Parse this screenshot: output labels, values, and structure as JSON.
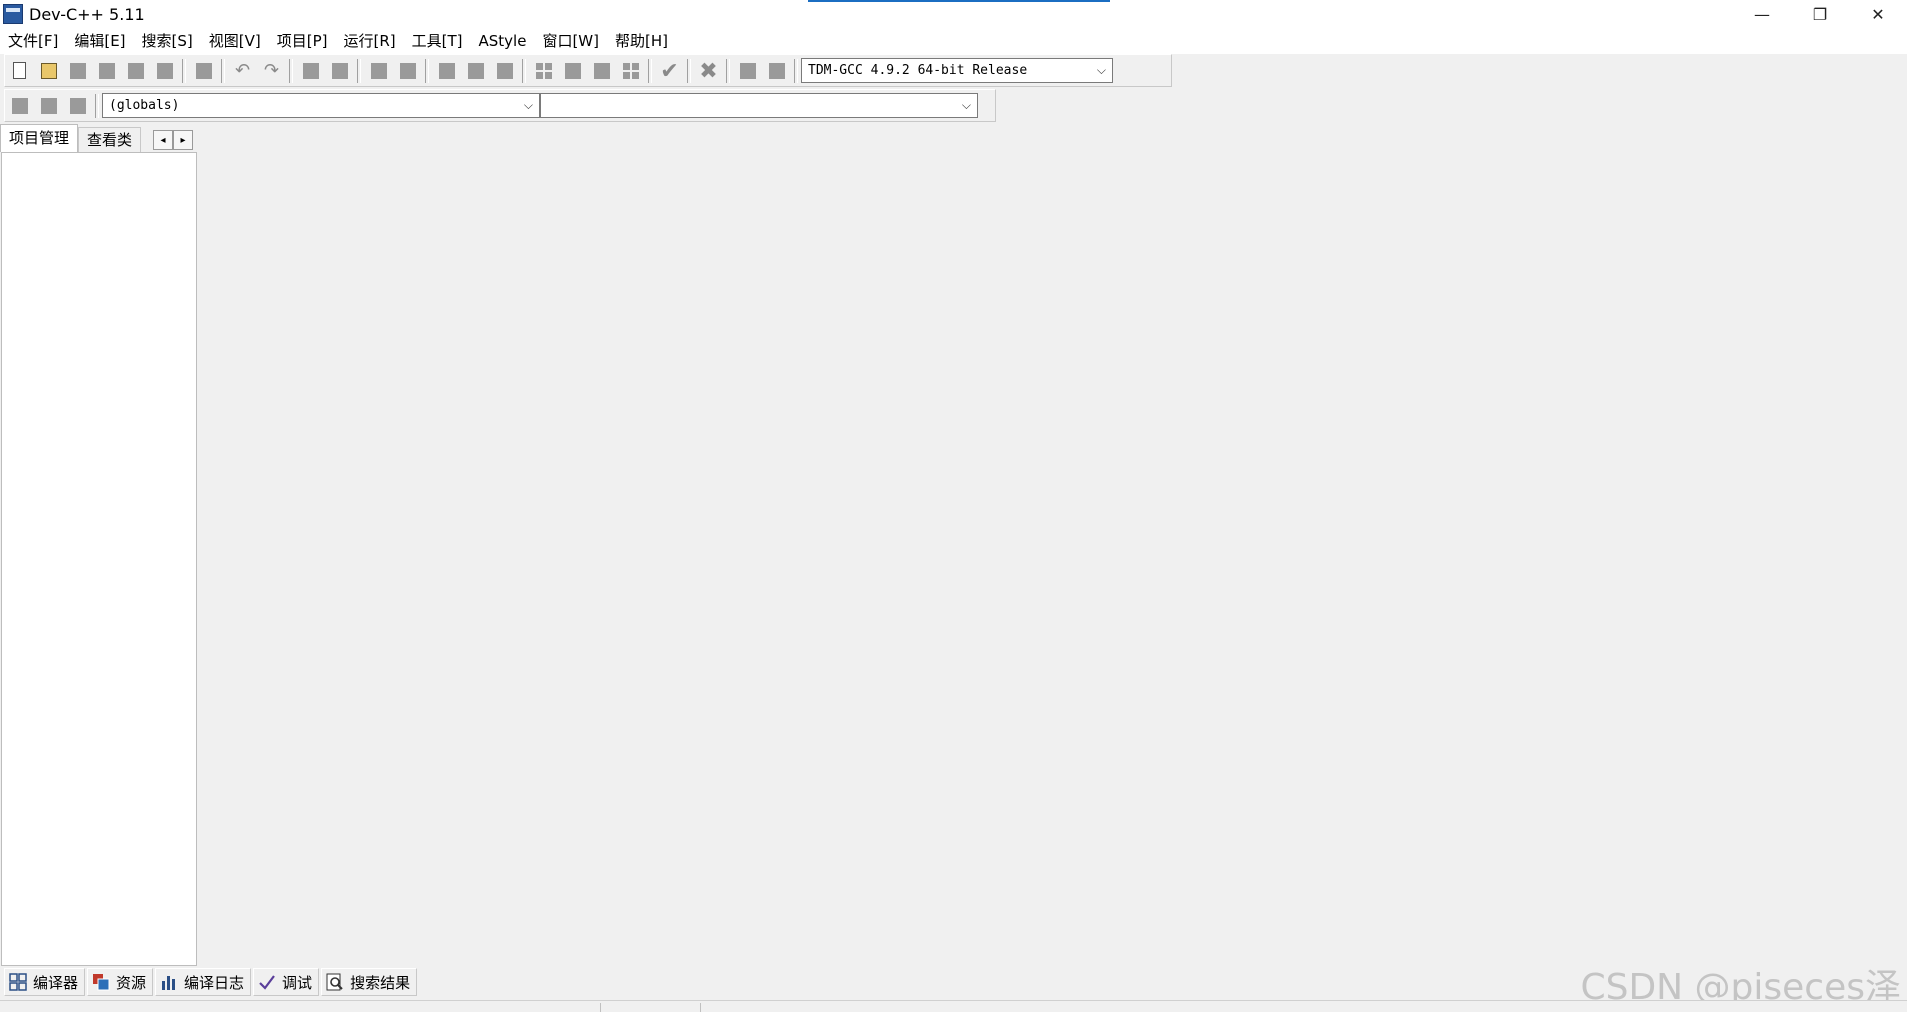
{
  "window": {
    "title": "Dev-C++ 5.11",
    "controls": {
      "minimize": "—",
      "restore": "❐",
      "close": "✕"
    }
  },
  "menu": [
    "文件[F]",
    "编辑[E]",
    "搜索[S]",
    "视图[V]",
    "项目[P]",
    "运行[R]",
    "工具[T]",
    "AStyle",
    "窗口[W]",
    "帮助[H]"
  ],
  "toolbar": {
    "compiler_select": "TDM-GCC 4.9.2 64-bit Release",
    "scope_select": "(globals)",
    "function_select": ""
  },
  "left_panel": {
    "tabs": [
      "项目管理",
      "查看类"
    ],
    "arrow_left": "◂",
    "arrow_right": "▸"
  },
  "bottom_tabs": [
    "编译器",
    "资源",
    "编译日志",
    "调试",
    "搜索结果"
  ],
  "watermark": "CSDN @piseces泽",
  "colors": {
    "accent": "#1b6ec2",
    "background": "#f0f0f0"
  }
}
